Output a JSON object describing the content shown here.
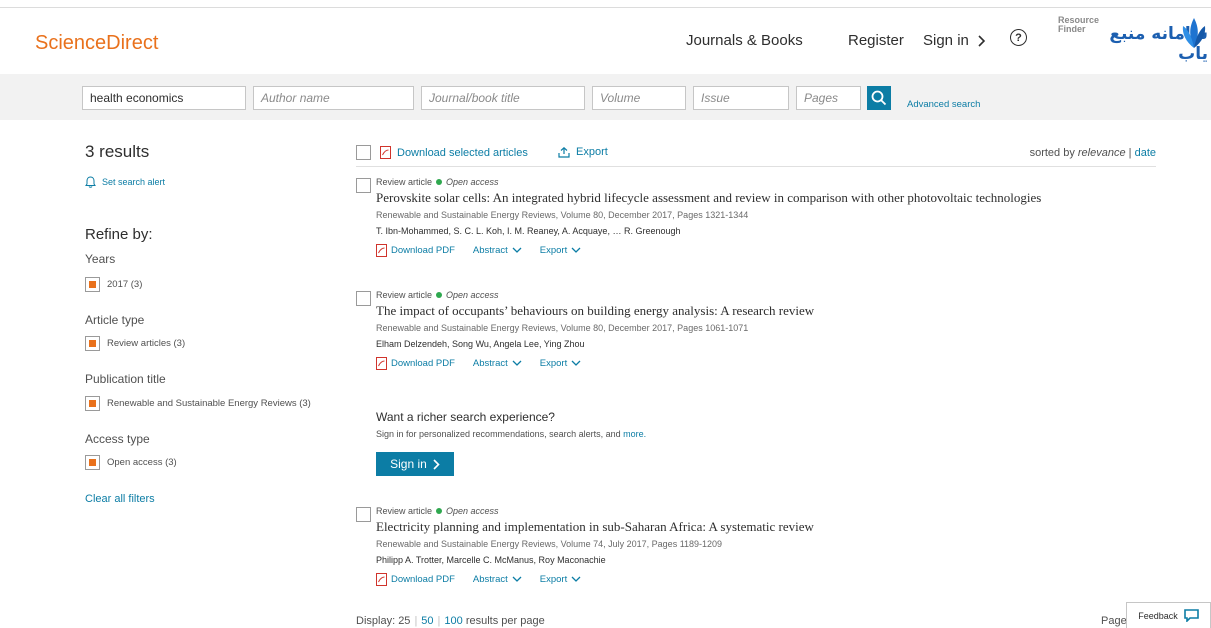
{
  "header": {
    "brand": "ScienceDirect",
    "nav": {
      "journals": "Journals & Books",
      "register": "Register",
      "signin": "Sign in",
      "help_icon": "help-circle-icon"
    },
    "logo": {
      "line1": "Resource",
      "line2": "Finder",
      "fa_text": "سامانه منبع یاب"
    }
  },
  "search": {
    "keywords_value": "health economics",
    "author_placeholder": "Author name",
    "journal_placeholder": "Journal/book title",
    "volume_placeholder": "Volume",
    "issue_placeholder": "Issue",
    "pages_placeholder": "Pages",
    "advanced_label": "Advanced search",
    "search_icon": "search-icon"
  },
  "results_meta": {
    "count": "3 results",
    "set_alert": "Set search alert",
    "sorted_prefix": "sorted by",
    "sort_relevance": "relevance",
    "sort_sep": "|",
    "sort_date": "date"
  },
  "refine": {
    "title": "Refine by:",
    "groups": [
      {
        "label": "Years",
        "item": "2017 (3)",
        "checked": true
      },
      {
        "label": "Article type",
        "item": "Review articles (3)",
        "checked": true
      },
      {
        "label": "Publication title",
        "item": "Renewable and Sustainable Energy Reviews (3)",
        "checked": true
      },
      {
        "label": "Access type",
        "item": "Open access (3)",
        "checked": true
      }
    ],
    "clear": "Clear all filters"
  },
  "toolbar": {
    "download_selected": "Download selected articles",
    "export": "Export"
  },
  "results": [
    {
      "type": "Review article",
      "access": "Open access",
      "title": "Perovskite solar cells: An integrated hybrid lifecycle assessment and review in comparison with other photovoltaic technologies",
      "source": "Renewable and Sustainable Energy Reviews, Volume 80, December 2017, Pages 1321-1344",
      "authors": "T. Ibn-Mohammed, S. C. L. Koh, I. M. Reaney, A. Acquaye, … R. Greenough"
    },
    {
      "type": "Review article",
      "access": "Open access",
      "title": "The impact of occupants’ behaviours on building energy analysis: A research review",
      "source": "Renewable and Sustainable Energy Reviews, Volume 80, December 2017, Pages 1061-1071",
      "authors": "Elham Delzendeh, Song Wu, Angela Lee, Ying Zhou"
    },
    {
      "type": "Review article",
      "access": "Open access",
      "title": "Electricity planning and implementation in sub-Saharan Africa: A systematic review",
      "source": "Renewable and Sustainable Energy Reviews, Volume 74, July 2017, Pages 1189-1209",
      "authors": "Philipp A. Trotter, Marcelle C. McManus, Roy Maconachie"
    }
  ],
  "actions": {
    "download_pdf": "Download PDF",
    "abstract": "Abstract",
    "export": "Export"
  },
  "promo": {
    "heading": "Want a richer search experience?",
    "text": "Sign in for personalized recommendations, search alerts, and",
    "more": "more.",
    "button": "Sign in"
  },
  "footer": {
    "display_label": "Display:",
    "opt25": "25",
    "opt50": "50",
    "opt100": "100",
    "per_page": "results per page",
    "page_label": "Page",
    "feedback": "Feedback"
  },
  "colors": {
    "brand": "#e9711c",
    "link": "#0c7da5",
    "open_access": "#2fa84f"
  }
}
